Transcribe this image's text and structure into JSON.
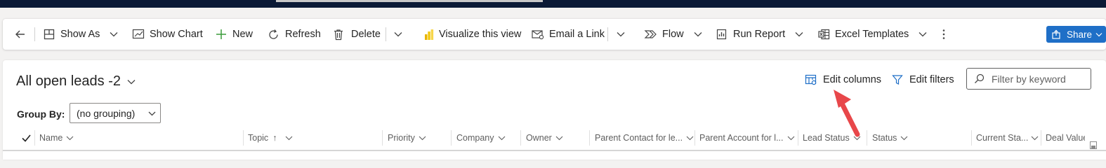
{
  "command_bar": {
    "show_as": "Show As",
    "show_chart": "Show Chart",
    "new": "New",
    "refresh": "Refresh",
    "delete": "Delete",
    "visualize": "Visualize this view",
    "email_link": "Email a Link",
    "flow": "Flow",
    "run_report": "Run Report",
    "excel_templates": "Excel Templates",
    "share": "Share"
  },
  "view": {
    "title": "All open leads -2",
    "edit_columns": "Edit columns",
    "edit_filters": "Edit filters",
    "filter_placeholder": "Filter by keyword",
    "group_by_label": "Group By:",
    "group_by_value": "(no grouping)"
  },
  "grid": {
    "columns": [
      "Name",
      "Topic",
      "Priority",
      "Company",
      "Owner",
      "Parent Contact for le...",
      "Parent Account for l...",
      "Lead Status",
      "Status",
      "Current Sta...",
      "Deal Value"
    ],
    "sort_indicator": "↑"
  },
  "colors": {
    "accent": "#1f6fc7",
    "top_bar": "#0b1a36",
    "annotation_arrow": "#e8474a"
  }
}
